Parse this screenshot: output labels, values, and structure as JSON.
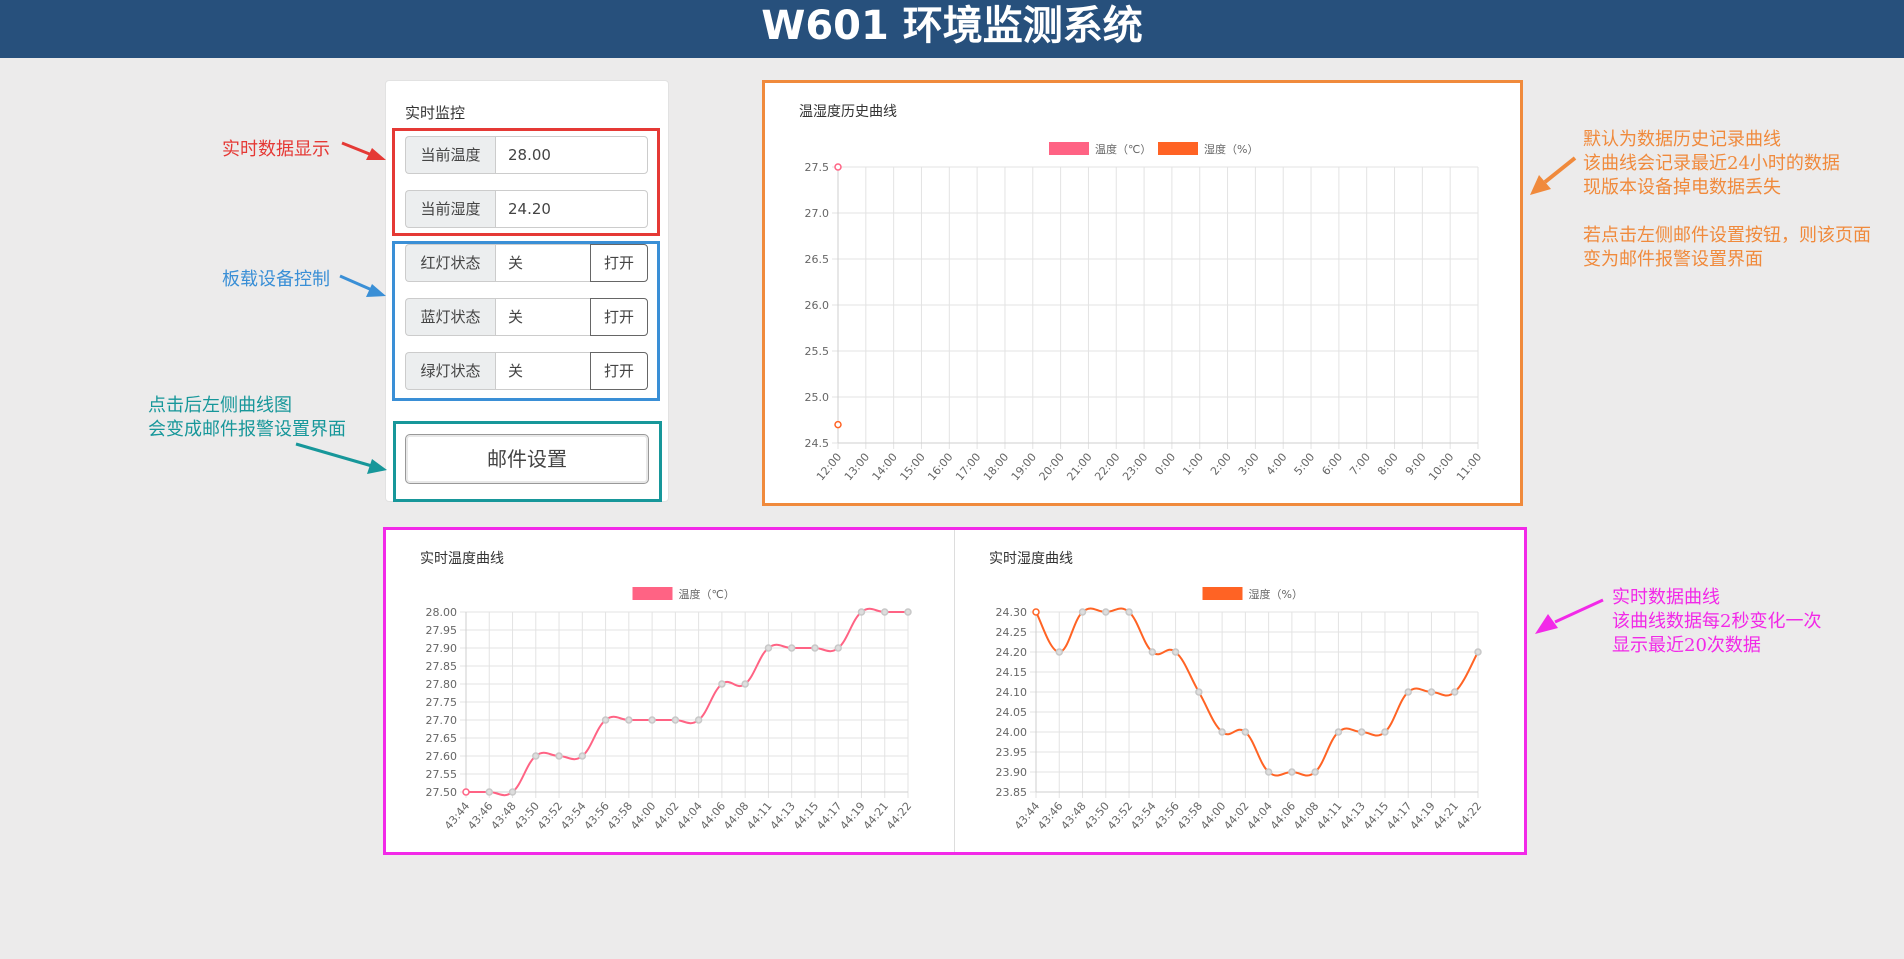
{
  "header": {
    "title": "W601 环境监测系统"
  },
  "monitor": {
    "title": "实时监控",
    "temp_label": "当前温度",
    "temp_value": "28.00",
    "hum_label": "当前湿度",
    "hum_value": "24.20",
    "leds": [
      {
        "label": "红灯状态",
        "state": "关",
        "button": "打开"
      },
      {
        "label": "蓝灯状态",
        "state": "关",
        "button": "打开"
      },
      {
        "label": "绿灯状态",
        "state": "关",
        "button": "打开"
      }
    ],
    "mail_button": "邮件设置"
  },
  "annotations": {
    "realtime_display": "实时数据显示",
    "board_control": "板载设备控制",
    "click_note_1": "点击后左侧曲线图",
    "click_note_2": "会变成邮件报警设置界面",
    "history_note_1": "默认为数据历史记录曲线",
    "history_note_2": "该曲线会记录最近24小时的数据",
    "history_note_3": "现版本设备掉电数据丢失",
    "history_note_4": "若点击左侧邮件设置按钮，则该页面",
    "history_note_5": "变为邮件报警设置界面",
    "realtime_note_1": "实时数据曲线",
    "realtime_note_2": "该曲线数据每2秒变化一次",
    "realtime_note_3": "显示最近20次数据"
  },
  "colors": {
    "header_bg": "#27507c",
    "temp_series": "#ff6384",
    "hum_series": "#ff6324",
    "red_box": "#e53935",
    "blue_box": "#3a8fd6",
    "teal_box": "#17979a",
    "orange_box": "#f08a3c",
    "magenta_box": "#f229e8"
  },
  "chart_data": [
    {
      "type": "line",
      "title": "温湿度历史曲线",
      "categories": [
        "12:00",
        "13:00",
        "14:00",
        "15:00",
        "16:00",
        "17:00",
        "18:00",
        "19:00",
        "20:00",
        "21:00",
        "22:00",
        "23:00",
        "0:00",
        "1:00",
        "2:00",
        "3:00",
        "4:00",
        "5:00",
        "6:00",
        "7:00",
        "8:00",
        "9:00",
        "10:00",
        "11:00"
      ],
      "y_ticks": [
        "27.5",
        "27.0",
        "26.5",
        "26.0",
        "25.5",
        "25.0",
        "24.5"
      ],
      "ylim": [
        24.5,
        27.5
      ],
      "series": [
        {
          "name": "温度（℃）",
          "values": [
            27.5
          ]
        },
        {
          "name": "湿度（%）",
          "values": [
            24.7
          ]
        }
      ],
      "grid": true,
      "legend": "top"
    },
    {
      "type": "line",
      "title": "实时温度曲线",
      "categories": [
        "43:44",
        "43:46",
        "43:48",
        "43:50",
        "43:52",
        "43:54",
        "43:56",
        "43:58",
        "44:00",
        "44:02",
        "44:04",
        "44:06",
        "44:08",
        "44:11",
        "44:13",
        "44:15",
        "44:17",
        "44:19",
        "44:21",
        "44:22"
      ],
      "y_ticks": [
        "28.00",
        "27.95",
        "27.90",
        "27.85",
        "27.80",
        "27.75",
        "27.70",
        "27.65",
        "27.60",
        "27.55",
        "27.50"
      ],
      "ylim": [
        27.5,
        28.0
      ],
      "series": [
        {
          "name": "温度（℃）",
          "values": [
            27.5,
            27.5,
            27.5,
            27.6,
            27.6,
            27.6,
            27.7,
            27.7,
            27.7,
            27.7,
            27.7,
            27.8,
            27.8,
            27.9,
            27.9,
            27.9,
            27.9,
            28.0,
            28.0,
            28.0
          ]
        }
      ],
      "grid": true,
      "legend": "top"
    },
    {
      "type": "line",
      "title": "实时湿度曲线",
      "categories": [
        "43:44",
        "43:46",
        "43:48",
        "43:50",
        "43:52",
        "43:54",
        "43:56",
        "43:58",
        "44:00",
        "44:02",
        "44:04",
        "44:06",
        "44:08",
        "44:11",
        "44:13",
        "44:15",
        "44:17",
        "44:19",
        "44:21",
        "44:22"
      ],
      "y_ticks": [
        "24.30",
        "24.25",
        "24.20",
        "24.15",
        "24.10",
        "24.05",
        "24.00",
        "23.95",
        "23.90",
        "23.85"
      ],
      "ylim": [
        23.85,
        24.3
      ],
      "series": [
        {
          "name": "湿度（%）",
          "values": [
            24.3,
            24.2,
            24.3,
            24.3,
            24.3,
            24.2,
            24.2,
            24.1,
            24.0,
            24.0,
            23.9,
            23.9,
            23.9,
            24.0,
            24.0,
            24.0,
            24.1,
            24.1,
            24.1,
            24.2
          ]
        }
      ],
      "grid": true,
      "legend": "top"
    }
  ]
}
